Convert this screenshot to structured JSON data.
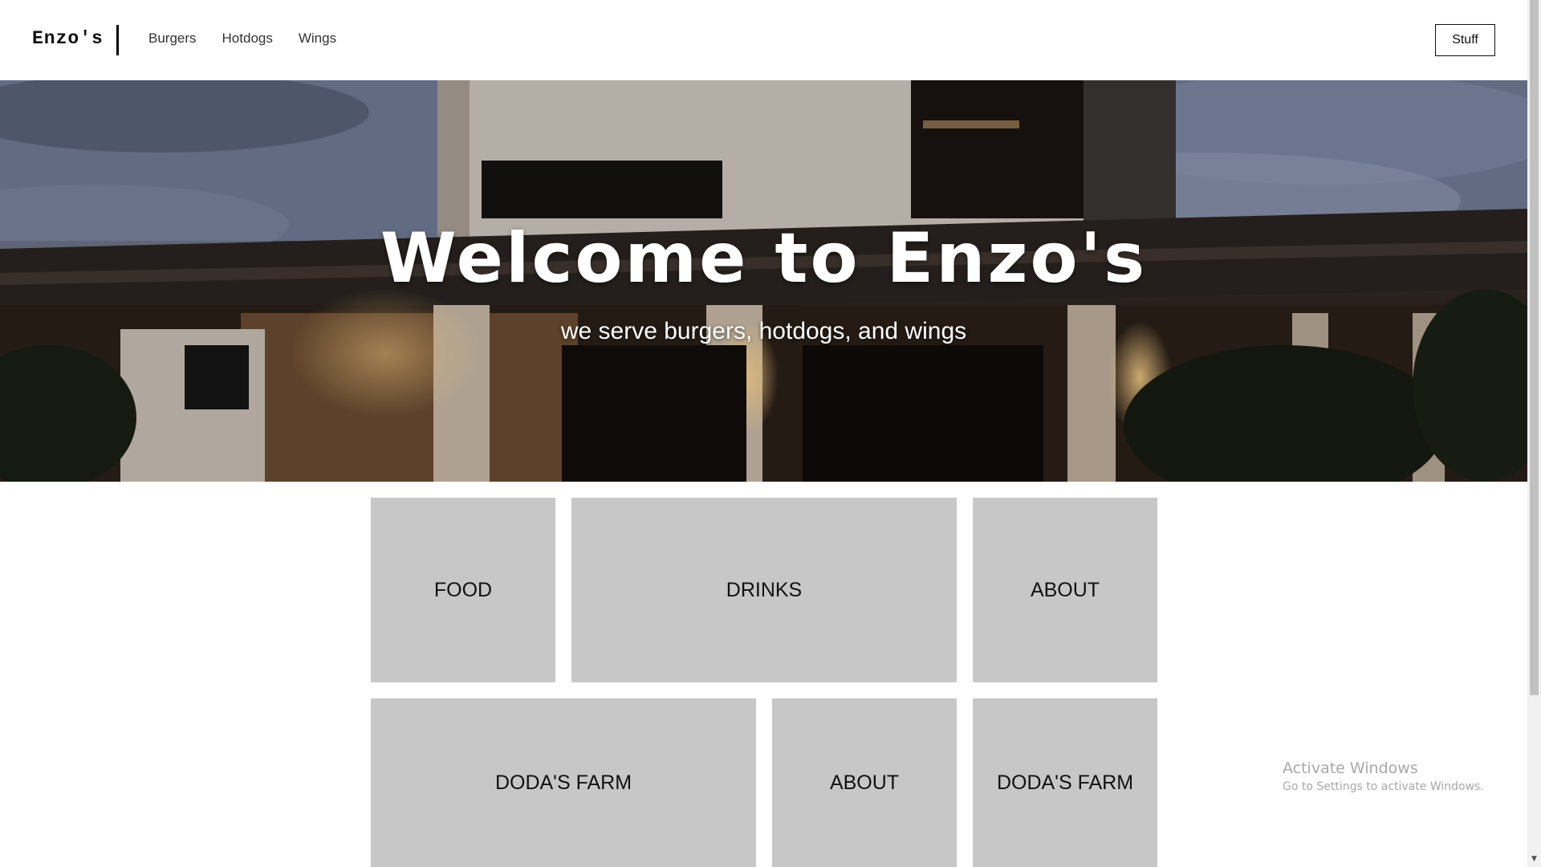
{
  "header": {
    "logo": "Enzo's",
    "nav": [
      "Burgers",
      "Hotdogs",
      "Wings"
    ],
    "button_label": "Stuff"
  },
  "hero": {
    "title": "Welcome to Enzo's",
    "subtitle": "we serve burgers, hotdogs, and wings"
  },
  "tiles": [
    "FOOD",
    "DRINKS",
    "ABOUT",
    "DODA'S FARM",
    "ABOUT",
    "DODA'S FARM"
  ],
  "watermark": {
    "title": "Activate Windows",
    "subtitle": "Go to Settings to activate Windows."
  },
  "colors": {
    "tile_bg": "#c8c7c7",
    "header_bg": "#ffffff",
    "text_dark": "#111111"
  }
}
